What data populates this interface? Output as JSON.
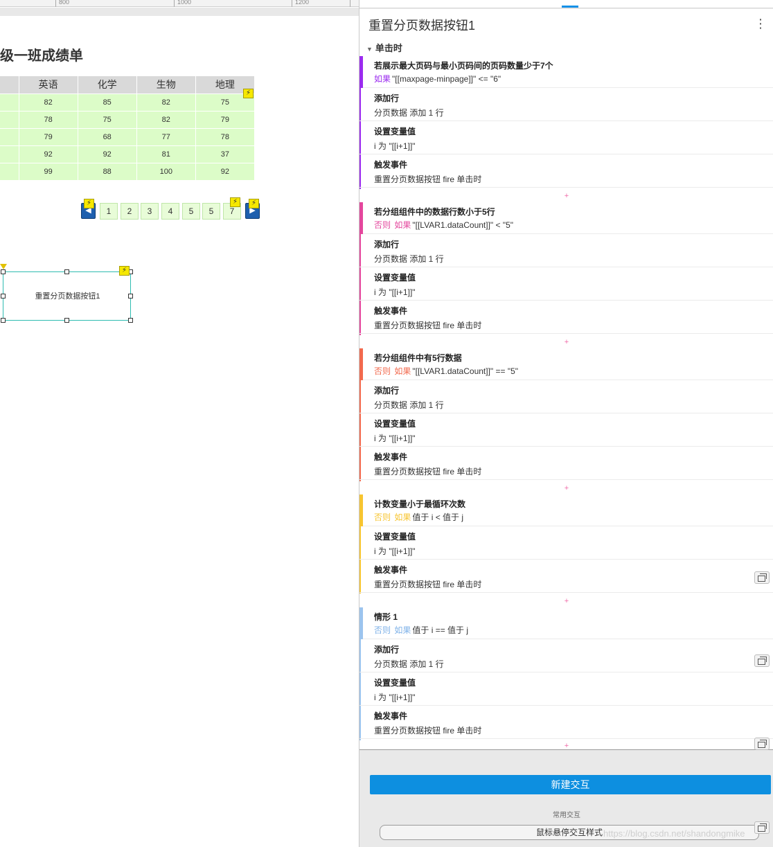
{
  "ruler": {
    "labels": [
      "800",
      "1000",
      "1200"
    ]
  },
  "canvas": {
    "heading": "级一班成绩单",
    "table": {
      "headers": [
        "英语",
        "化学",
        "生物",
        "地理"
      ],
      "rows": [
        [
          "82",
          "85",
          "82",
          "75"
        ],
        [
          "78",
          "75",
          "82",
          "79"
        ],
        [
          "79",
          "68",
          "77",
          "78"
        ],
        [
          "92",
          "92",
          "81",
          "37"
        ],
        [
          "99",
          "88",
          "100",
          "92"
        ]
      ]
    },
    "pager": [
      "1",
      "2",
      "3",
      "4",
      "5",
      "5",
      "7"
    ],
    "selected_widget_label": "重置分页数据按钮1"
  },
  "panel": {
    "title": "重置分页数据按钮1",
    "event": "单击时",
    "cases": [
      {
        "name": "若展示最大页码与最小页码间的页码数量少于7个",
        "else": "",
        "if": "如果",
        "condition": "\"[[maxpage-minpage]]\" <= \"6\"",
        "color": "#9b2bef",
        "actions": [
          {
            "title": "添加行",
            "detail": "分页数据 添加 1 行"
          },
          {
            "title": "设置变量值",
            "detail": "i 为 \"[[i+1]]\""
          },
          {
            "title": "触发事件",
            "detail": "重置分页数据按钮 fire 单击时"
          }
        ]
      },
      {
        "name": "若分组组件中的数据行数小于5行",
        "else": "否则",
        "if": "如果",
        "condition": "\"[[LVAR1.dataCount]]\" < \"5\"",
        "color": "#e4479d",
        "actions": [
          {
            "title": "添加行",
            "detail": "分页数据 添加 1 行"
          },
          {
            "title": "设置变量值",
            "detail": "i 为 \"[[i+1]]\""
          },
          {
            "title": "触发事件",
            "detail": "重置分页数据按钮 fire 单击时"
          }
        ]
      },
      {
        "name": "若分组组件中有5行数据",
        "else": "否则",
        "if": "如果",
        "condition": "\"[[LVAR1.dataCount]]\" == \"5\"",
        "color": "#f26a4e",
        "actions": [
          {
            "title": "添加行",
            "detail": "分页数据 添加 1 行"
          },
          {
            "title": "设置变量值",
            "detail": "i 为 \"[[i+1]]\""
          },
          {
            "title": "触发事件",
            "detail": "重置分页数据按钮 fire 单击时"
          }
        ]
      },
      {
        "name": "计数变量小于最循环次数",
        "else": "否则",
        "if": "如果",
        "condition": "值于 i < 值于 j",
        "color": "#f7c531",
        "actions": [
          {
            "title": "设置变量值",
            "detail": "i 为 \"[[i+1]]\""
          },
          {
            "title": "触发事件",
            "detail": "重置分页数据按钮 fire 单击时"
          }
        ]
      },
      {
        "name": "情形 1",
        "else": "否则",
        "if": "如果",
        "condition": "值于 i == 值于 j",
        "color": "#9cc4ee",
        "actions": [
          {
            "title": "添加行",
            "detail": "分页数据 添加 1 行"
          },
          {
            "title": "设置变量值",
            "detail": "i 为 \"[[i+1]]\""
          },
          {
            "title": "触发事件",
            "detail": "重置分页数据按钮 fire 单击时"
          }
        ]
      }
    ],
    "new_interaction": "新建交互",
    "common_label": "常用交互",
    "hover_button": "鼠标悬停交互样式"
  },
  "watermark": "https://blog.csdn.net/shandongmike",
  "colors": {
    "accent": "#0d8fe0",
    "selection": "#2dbbb0",
    "table_header": "#d9d9d9",
    "table_body": "#dcfcc8",
    "pager_button": "#e8fcd8",
    "lightning_badge": "#f6e800"
  },
  "icons": [
    "lightning-icon",
    "prev-page-icon",
    "next-page-icon",
    "more-icon",
    "copy-icon",
    "collapse-caret-icon",
    "plus-icon"
  ]
}
